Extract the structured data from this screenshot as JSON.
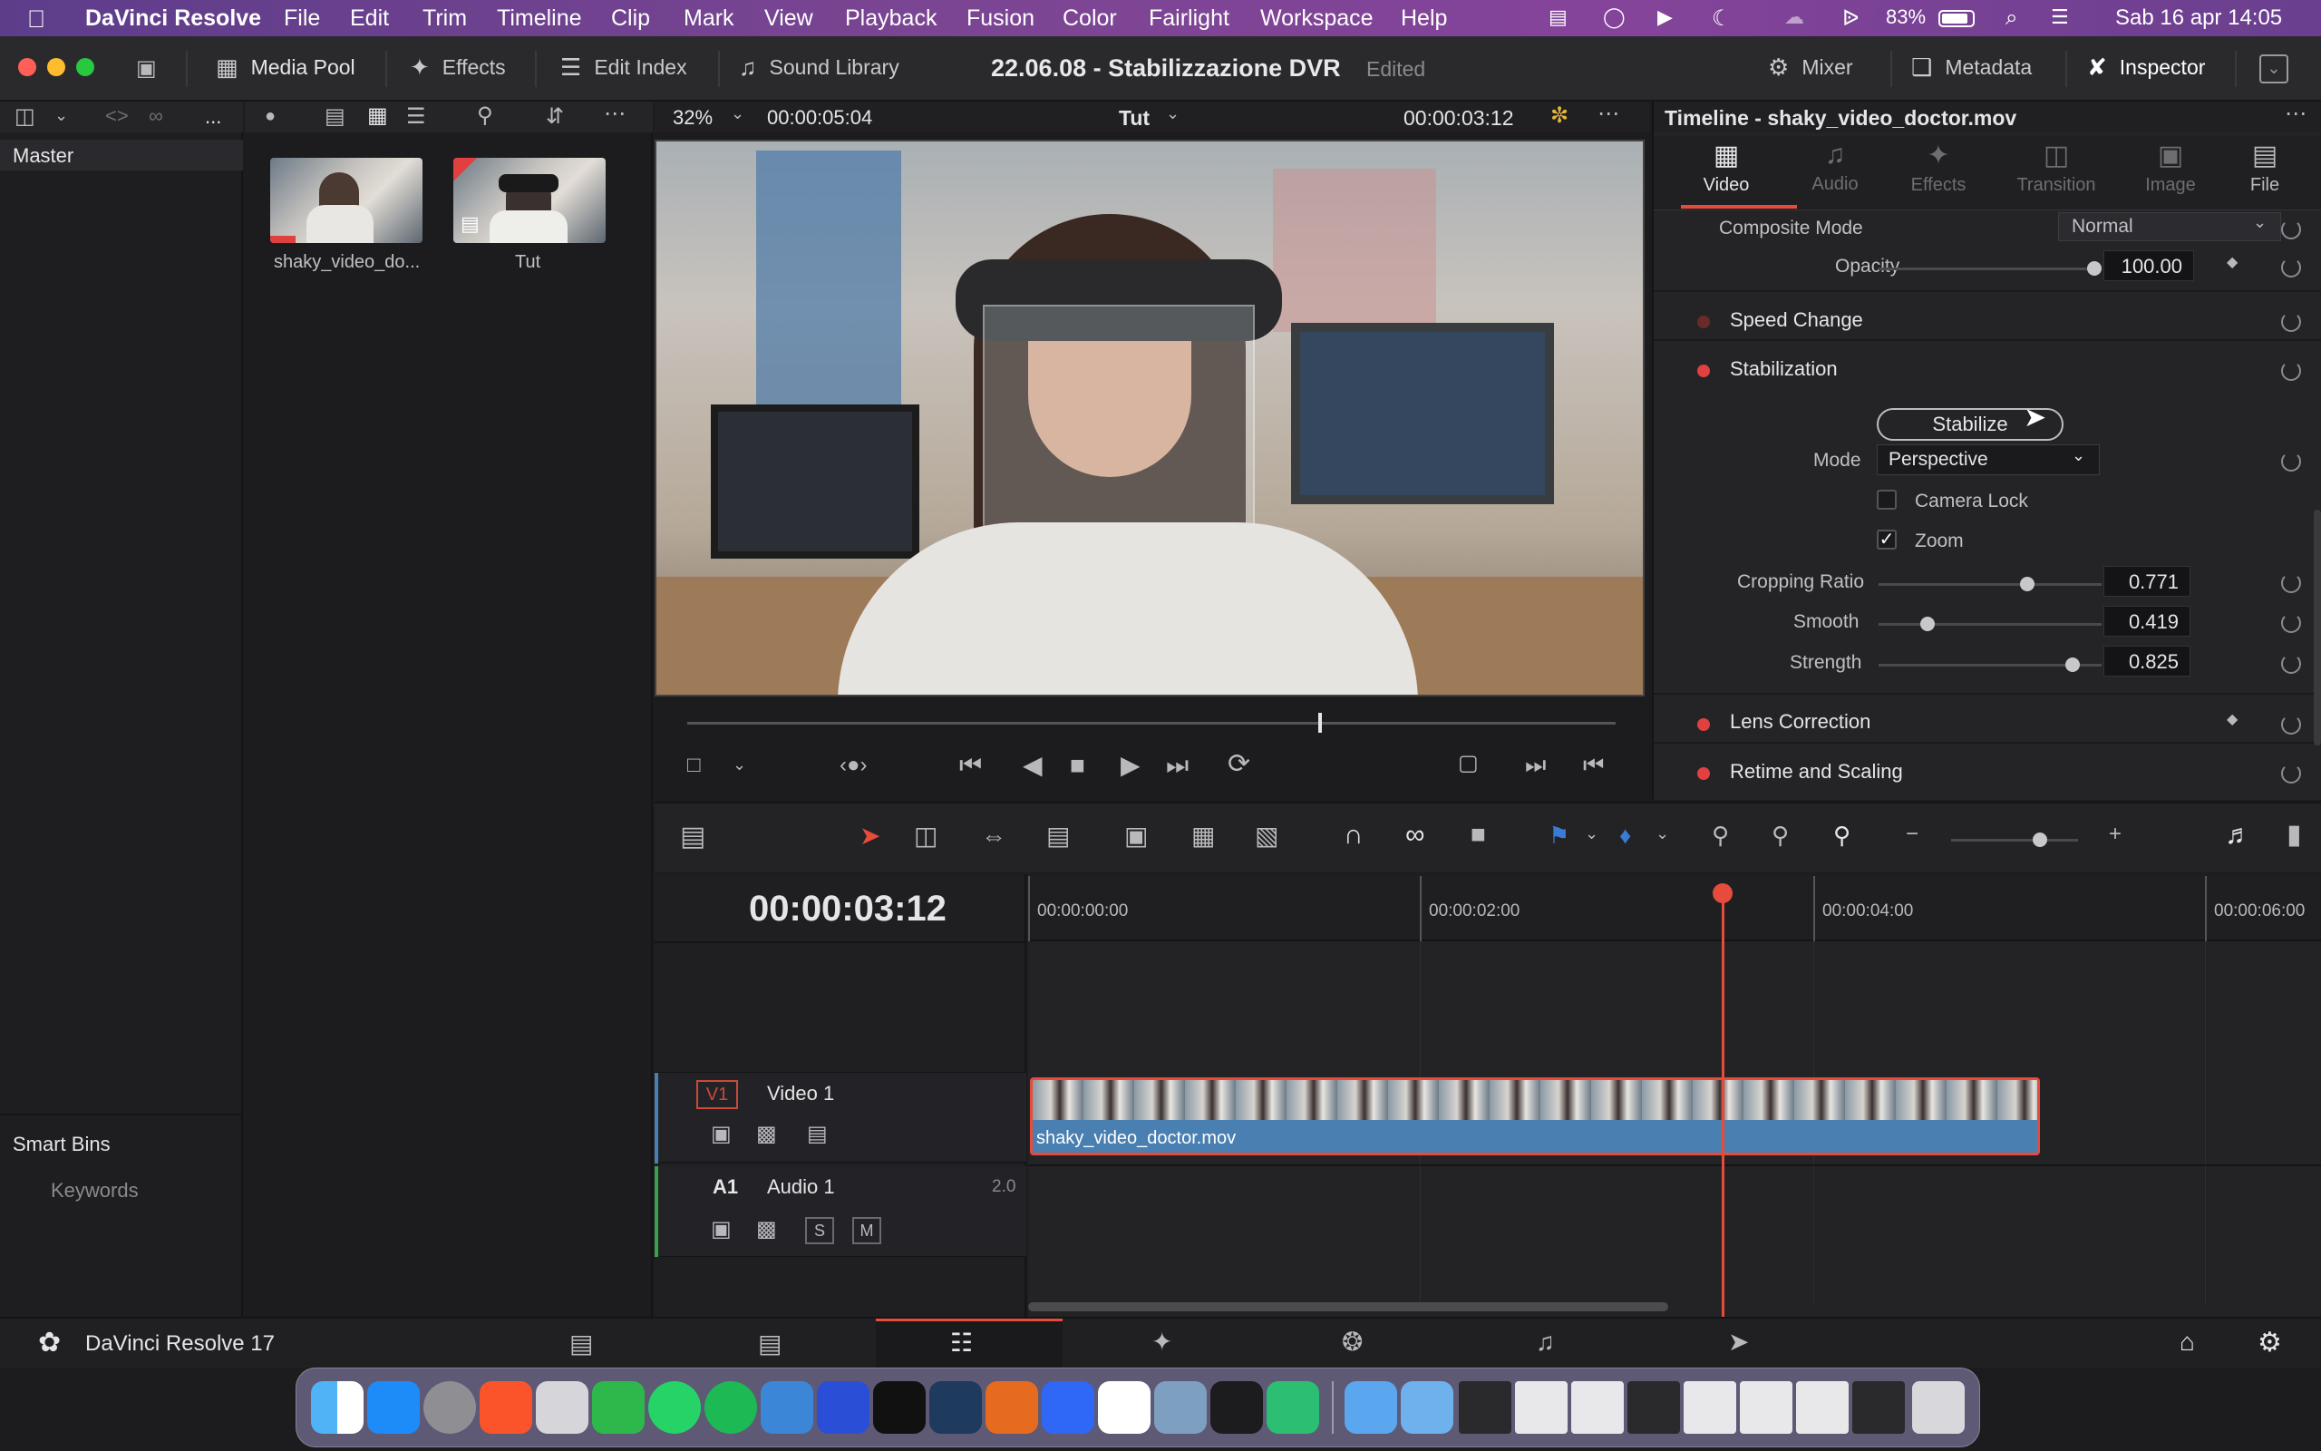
{
  "menubar": {
    "app_name": "DaVinci Resolve",
    "items": [
      "File",
      "Edit",
      "Trim",
      "Timeline",
      "Clip",
      "Mark",
      "View",
      "Playback",
      "Fusion",
      "Color",
      "Fairlight",
      "Workspace",
      "Help"
    ],
    "battery": "83%",
    "datetime": "Sab 16 apr  14:05"
  },
  "toolbar": {
    "media_pool": "Media Pool",
    "effects": "Effects",
    "edit_index": "Edit Index",
    "sound_library": "Sound Library",
    "project_title": "22.06.08 - Stabilizzazione DVR",
    "edited": "Edited",
    "mixer": "Mixer",
    "metadata": "Metadata",
    "inspector": "Inspector"
  },
  "media_pool": {
    "more": "...",
    "bins_root": "Master",
    "smart_bins": "Smart Bins",
    "keywords": "Keywords",
    "clips": [
      {
        "name": "shaky_video_do..."
      },
      {
        "name": "Tut"
      }
    ]
  },
  "viewer": {
    "zoom": "32%",
    "source_duration": "00:00:05:04",
    "timeline_name": "Tut",
    "current_timecode": "00:00:03:12",
    "playhead_fraction": 0.68
  },
  "inspector": {
    "title": "Timeline - shaky_video_doctor.mov",
    "tabs": [
      "Video",
      "Audio",
      "Effects",
      "Transition",
      "Image",
      "File"
    ],
    "active_tab": "Video",
    "composite_mode_label": "Composite Mode",
    "composite_mode_value": "Normal",
    "opacity_label": "Opacity",
    "opacity_value": "100.00",
    "speed_change": "Speed Change",
    "stabilization": "Stabilization",
    "stabilize_button": "Stabilize",
    "mode_label": "Mode",
    "mode_value": "Perspective",
    "camera_lock": "Camera Lock",
    "zoom": "Zoom",
    "cropping_ratio_label": "Cropping Ratio",
    "cropping_ratio_value": "0.771",
    "smooth_label": "Smooth",
    "smooth_value": "0.419",
    "strength_label": "Strength",
    "strength_value": "0.825",
    "lens_correction": "Lens Correction",
    "retime_scaling": "Retime and Scaling"
  },
  "timeline": {
    "timecode": "00:00:03:12",
    "ruler": [
      "00:00:00:00",
      "00:00:02:00",
      "00:00:04:00",
      "00:00:06:00"
    ],
    "video_track_id": "V1",
    "video_track_name": "Video 1",
    "audio_track_id": "A1",
    "audio_track_name": "Audio 1",
    "audio_channels": "2.0",
    "solo": "S",
    "mute": "M",
    "clip_name": "shaky_video_doctor.mov"
  },
  "footer": {
    "app_version": "DaVinci Resolve 17"
  },
  "colors": {
    "accent_red": "#e64b3b",
    "clip_blue": "#4a7fb1",
    "menubar_purple": "#7b4593"
  }
}
